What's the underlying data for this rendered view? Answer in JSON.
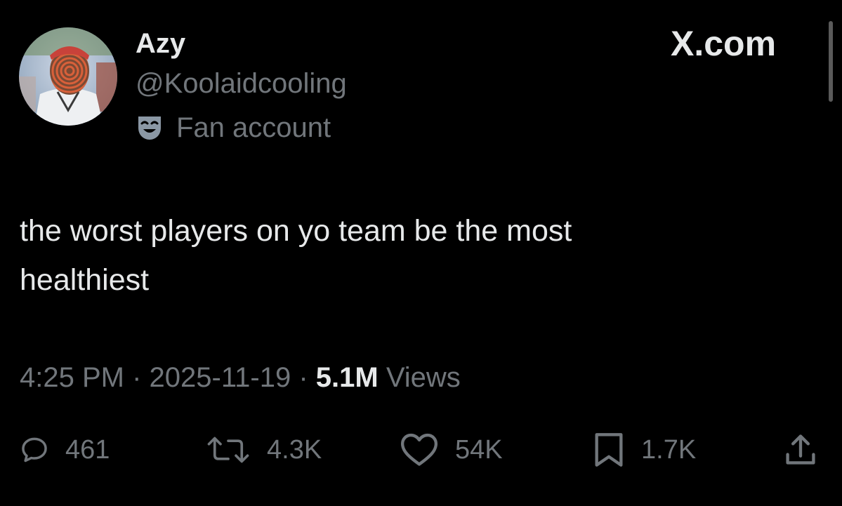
{
  "author": {
    "display_name": "Azy",
    "handle": "@Koolaidcooling",
    "label_icon": "theater-mask-icon",
    "label_text": "Fan account"
  },
  "site_logo": "X.com",
  "tweet": {
    "text_lines": [
      "the worst players on yo team be the most",
      "healthiest"
    ]
  },
  "meta": {
    "time": "4:25 PM",
    "separator": "·",
    "date": "2025-11-19",
    "views_count": "5.1M",
    "views_label": "Views"
  },
  "actions": {
    "reply": {
      "icon": "reply-icon",
      "count": "461"
    },
    "retweet": {
      "icon": "retweet-icon",
      "count": "4.3K"
    },
    "like": {
      "icon": "heart-icon",
      "count": "54K"
    },
    "bookmark": {
      "icon": "bookmark-icon",
      "count": "1.7K"
    },
    "share": {
      "icon": "share-icon"
    }
  },
  "colors": {
    "background": "#000000",
    "primary_text": "#e7e9ea",
    "secondary_text": "#71767b"
  }
}
